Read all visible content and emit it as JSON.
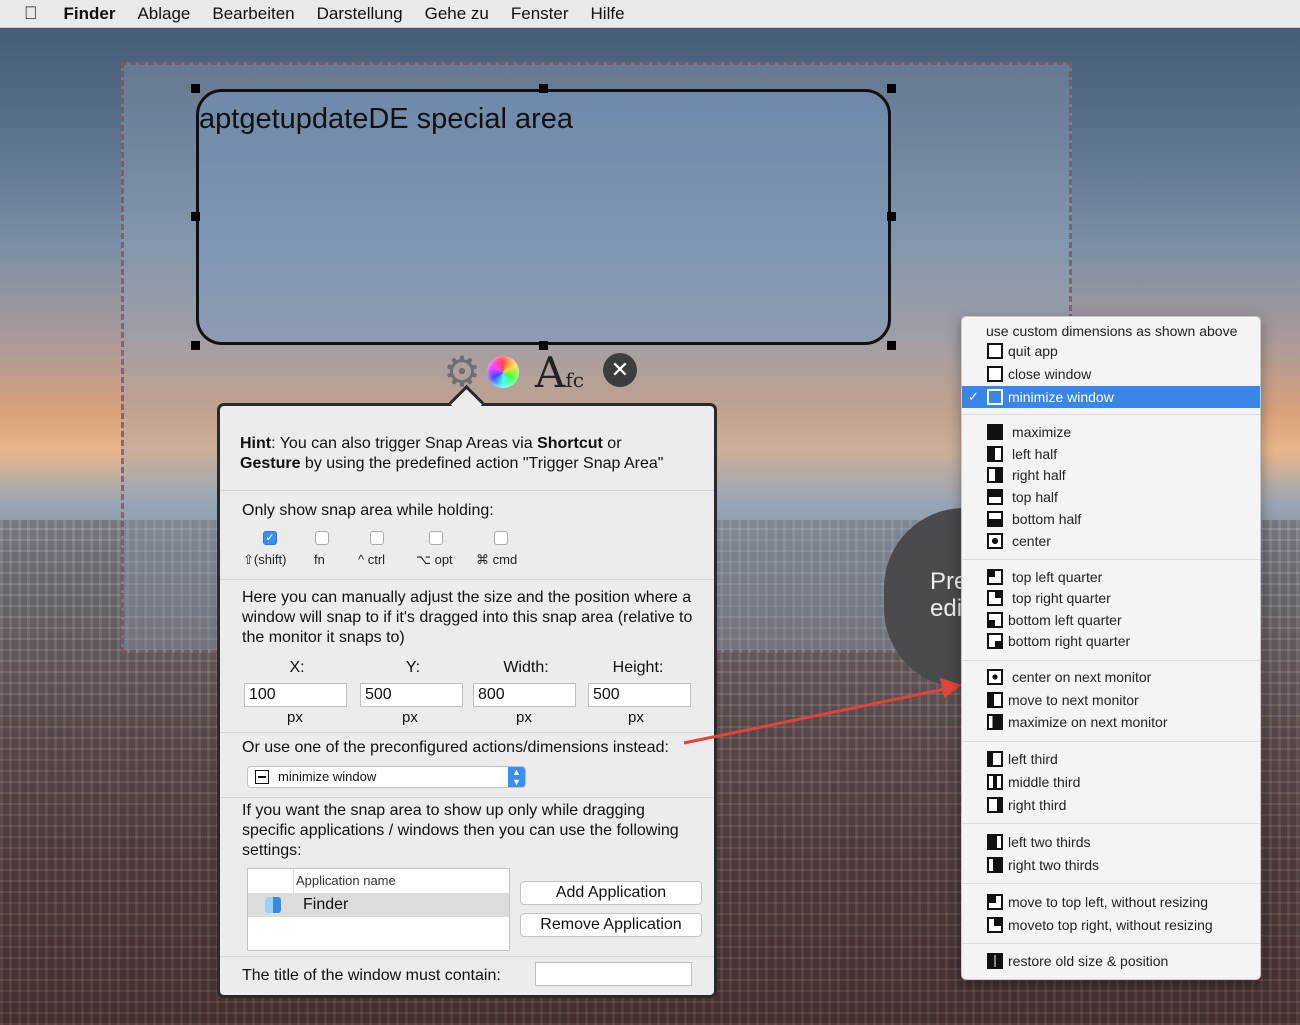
{
  "menubar": {
    "apple": "",
    "app": "Finder",
    "items": [
      "Ablage",
      "Bearbeiten",
      "Darstellung",
      "Gehe zu",
      "Fenster",
      "Hilfe"
    ]
  },
  "snap_area": {
    "title": "aptgetupdateDE special area"
  },
  "popover": {
    "hint_bold1": "Hint",
    "hint_text1": ": You can also trigger Snap Areas via ",
    "hint_bold2": "Shortcut",
    "hint_text2": " or",
    "hint_bold3": "Gesture",
    "hint_text3": " by using the predefined action \"Trigger Snap Area\"",
    "modifiers_label": "Only show snap area while holding:",
    "modifiers": [
      {
        "label": "⇧(shift)",
        "checked": true
      },
      {
        "label": "fn",
        "checked": false
      },
      {
        "label": "^ ctrl",
        "checked": false
      },
      {
        "label": "⌥ opt",
        "checked": false
      },
      {
        "label": "⌘ cmd",
        "checked": false
      }
    ],
    "manual_text": "Here you can manually adjust the size and the position where a window will snap to if it's dragged into this snap area (relative to the monitor it snaps to)",
    "x_label": "X:",
    "y_label": "Y:",
    "width_label": "Width:",
    "height_label": "Height:",
    "x_value": "100",
    "y_value": "500",
    "width_value": "800",
    "height_value": "500",
    "unit": "px",
    "preconfigured_label": "Or use one of the preconfigured actions/dimensions instead:",
    "selected_action": "minimize window",
    "apps_text": "If you want the snap area to show up only while dragging specific applications / windows then you can use the following settings:",
    "table_header": "Application name",
    "apps": [
      "Finder"
    ],
    "add_button": "Add Application",
    "remove_button": "Remove Application",
    "title_contains_label": "The title of the window must contain:",
    "title_contains_value": ""
  },
  "preview": {
    "line1": "Pre",
    "line2": "edi"
  },
  "action_menu": {
    "groups": [
      [
        "use custom dimensions as shown above",
        "quit app",
        "close window",
        "minimize window"
      ],
      [
        "maximize",
        "left half",
        "right half",
        "top half",
        "bottom half",
        "center"
      ],
      [
        "top left quarter",
        "top right quarter",
        "bottom left quarter",
        "bottom right quarter"
      ],
      [
        "center on next monitor",
        "move to next monitor",
        "maximize on next monitor"
      ],
      [
        "left third",
        "middle third",
        "right third"
      ],
      [
        "left two thirds",
        "right two thirds"
      ],
      [
        "move to top left, without resizing",
        "moveto top right, without resizing"
      ],
      [
        "restore old size & position"
      ]
    ],
    "selected": "minimize window",
    "check": "✓"
  },
  "colors": {
    "accent": "#3a86e8",
    "arrow": "#e0443a"
  }
}
